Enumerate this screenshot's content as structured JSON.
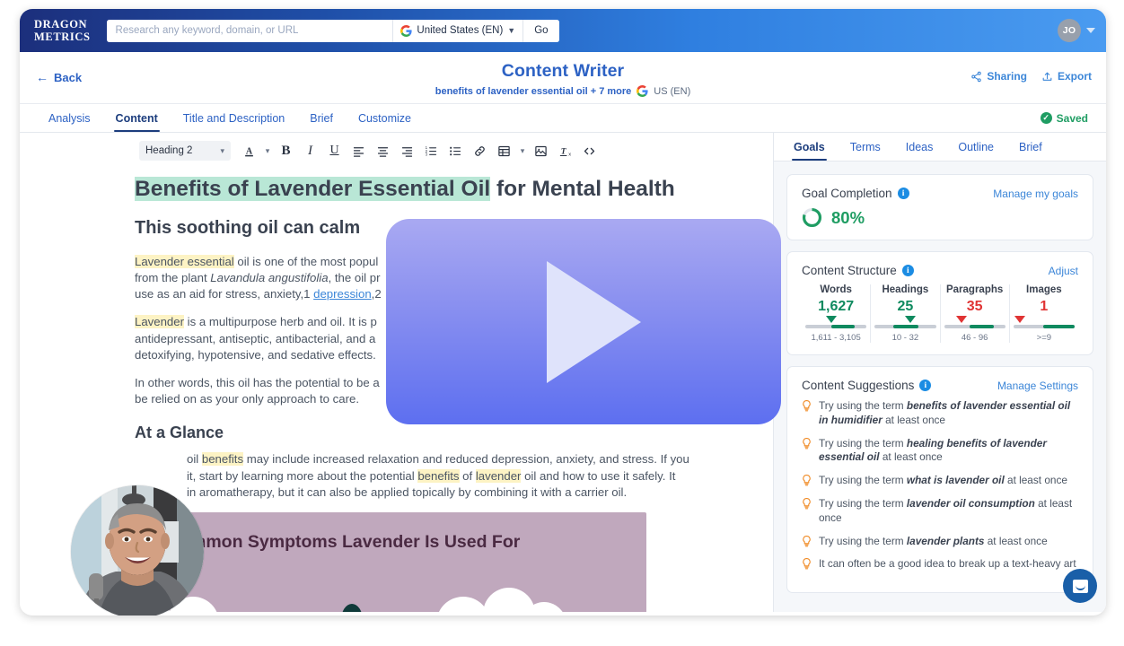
{
  "topbar": {
    "logo_line1": "DRAGON",
    "logo_line2": "METRICS",
    "search_placeholder": "Research any keyword, domain, or URL",
    "search_value": "",
    "locale_label": "United States (EN)",
    "go_label": "Go",
    "avatar_initials": "JO"
  },
  "header": {
    "back_label": "Back",
    "title": "Content Writer",
    "subtitle": "benefits of lavender essential oil + 7 more",
    "subtitle_locale": "US (EN)",
    "sharing_label": "Sharing",
    "export_label": "Export"
  },
  "tabs": {
    "items": [
      {
        "label": "Analysis"
      },
      {
        "label": "Content"
      },
      {
        "label": "Title and Description"
      },
      {
        "label": "Brief"
      },
      {
        "label": "Customize"
      }
    ],
    "active": "Content",
    "saved_label": "Saved"
  },
  "editor_toolbar": {
    "format_value": "Heading 2",
    "buttons": [
      "text-color-icon",
      "bold-icon",
      "italic-icon",
      "underline-icon",
      "align-left-icon",
      "align-center-icon",
      "align-right-icon",
      "ordered-list-icon",
      "bullet-list-icon",
      "link-icon",
      "table-icon",
      "image-icon",
      "clear-format-icon",
      "code-icon"
    ]
  },
  "document": {
    "h1_highlight": "Benefits of Lavender Essential Oil",
    "h1_rest": " for Mental Health",
    "h2": "This soothing oil can calm",
    "p1_a": "Lavender essential",
    "p1_b": " oil is one of the most popul",
    "p1_c": "from the plant ",
    "p1_d": "Lavandula angustifolia",
    "p1_e": ", the oil pr",
    "p1_f": "use as an aid for stress, anxiety,1 ",
    "p1_link": "depression",
    "p1_g": ",2",
    "p2_a": "Lavender",
    "p2_b": " is a multipurpose herb and oil. It is p",
    "p2_c": "antidepressant, antiseptic, antibacterial, and a",
    "p2_d": "detoxifying, hypotensive, and sedative effects.",
    "p3_a": "In other words, this oil has the potential to be a",
    "p3_b": "be relied on as your only approach to care.",
    "h3": "At a Glance",
    "p4_a": " oil ",
    "p4_hl1": "benefits",
    "p4_b": " may include increased relaxation and reduced depression, anxiety, and stress. If you",
    "p4_c": " it, start by learning more about the potential ",
    "p4_hl2": "benefits",
    "p4_d": " of ",
    "p4_hl3": "lavender",
    "p4_e": " oil and how to use it safely. It",
    "p4_f": " in aromatherapy, but it can also be applied topically by combining it with a carrier oil.",
    "image_caption": "Common Symptoms Lavender Is Used For"
  },
  "sidebar": {
    "tabs": [
      {
        "label": "Goals"
      },
      {
        "label": "Terms"
      },
      {
        "label": "Ideas"
      },
      {
        "label": "Outline"
      },
      {
        "label": "Brief"
      }
    ],
    "active_tab": "Goals",
    "goal_card": {
      "title": "Goal Completion",
      "link": "Manage my goals",
      "percent": "80%",
      "percent_value": 80
    },
    "structure_card": {
      "title": "Content Structure",
      "link": "Adjust",
      "metrics": [
        {
          "label": "Words",
          "value": "1,627",
          "status": "good",
          "range": "1,611 - 3,105",
          "marker_pct": 42,
          "fill_start": 42,
          "fill_end": 80
        },
        {
          "label": "Headings",
          "value": "25",
          "status": "good",
          "range": "10 - 32",
          "marker_pct": 58,
          "fill_start": 30,
          "fill_end": 72
        },
        {
          "label": "Paragraphs",
          "value": "35",
          "status": "bad",
          "range": "46 - 96",
          "marker_pct": 28,
          "fill_start": 42,
          "fill_end": 82
        },
        {
          "label": "Images",
          "value": "1",
          "status": "bad",
          "range": ">=9",
          "marker_pct": 10,
          "fill_start": 48,
          "fill_end": 100
        }
      ]
    },
    "suggestions_card": {
      "title": "Content Suggestions",
      "link": "Manage Settings",
      "items": [
        {
          "pre": "Try using the term ",
          "term": "benefits of lavender essential oil in humidifier",
          "post": " at least once"
        },
        {
          "pre": "Try using the term ",
          "term": "healing benefits of lavender essential oil",
          "post": " at least once"
        },
        {
          "pre": "Try using the term ",
          "term": "what is lavender oil",
          "post": " at least once"
        },
        {
          "pre": "Try using the term ",
          "term": "lavender oil consumption",
          "post": " at least once"
        },
        {
          "pre": "Try using the term ",
          "term": "lavender plants",
          "post": " at least once"
        },
        {
          "pre": "It can often be a good idea to break up a text-heavy art",
          "term": "",
          "post": ""
        }
      ]
    }
  },
  "overlays": {
    "play_button": "play-button-overlay",
    "webcam": "presenter-webcam-circle",
    "chat": "chat-widget-button"
  },
  "colors": {
    "brand_blue": "#2d62c4",
    "accent_green": "#1f9d63",
    "alert_red": "#e03434",
    "highlight_yellow": "#fdf3c4",
    "highlight_green": "#b9e7d6",
    "play_overlay_from": "#a9a9f2",
    "play_overlay_to": "#5d6ff0"
  }
}
